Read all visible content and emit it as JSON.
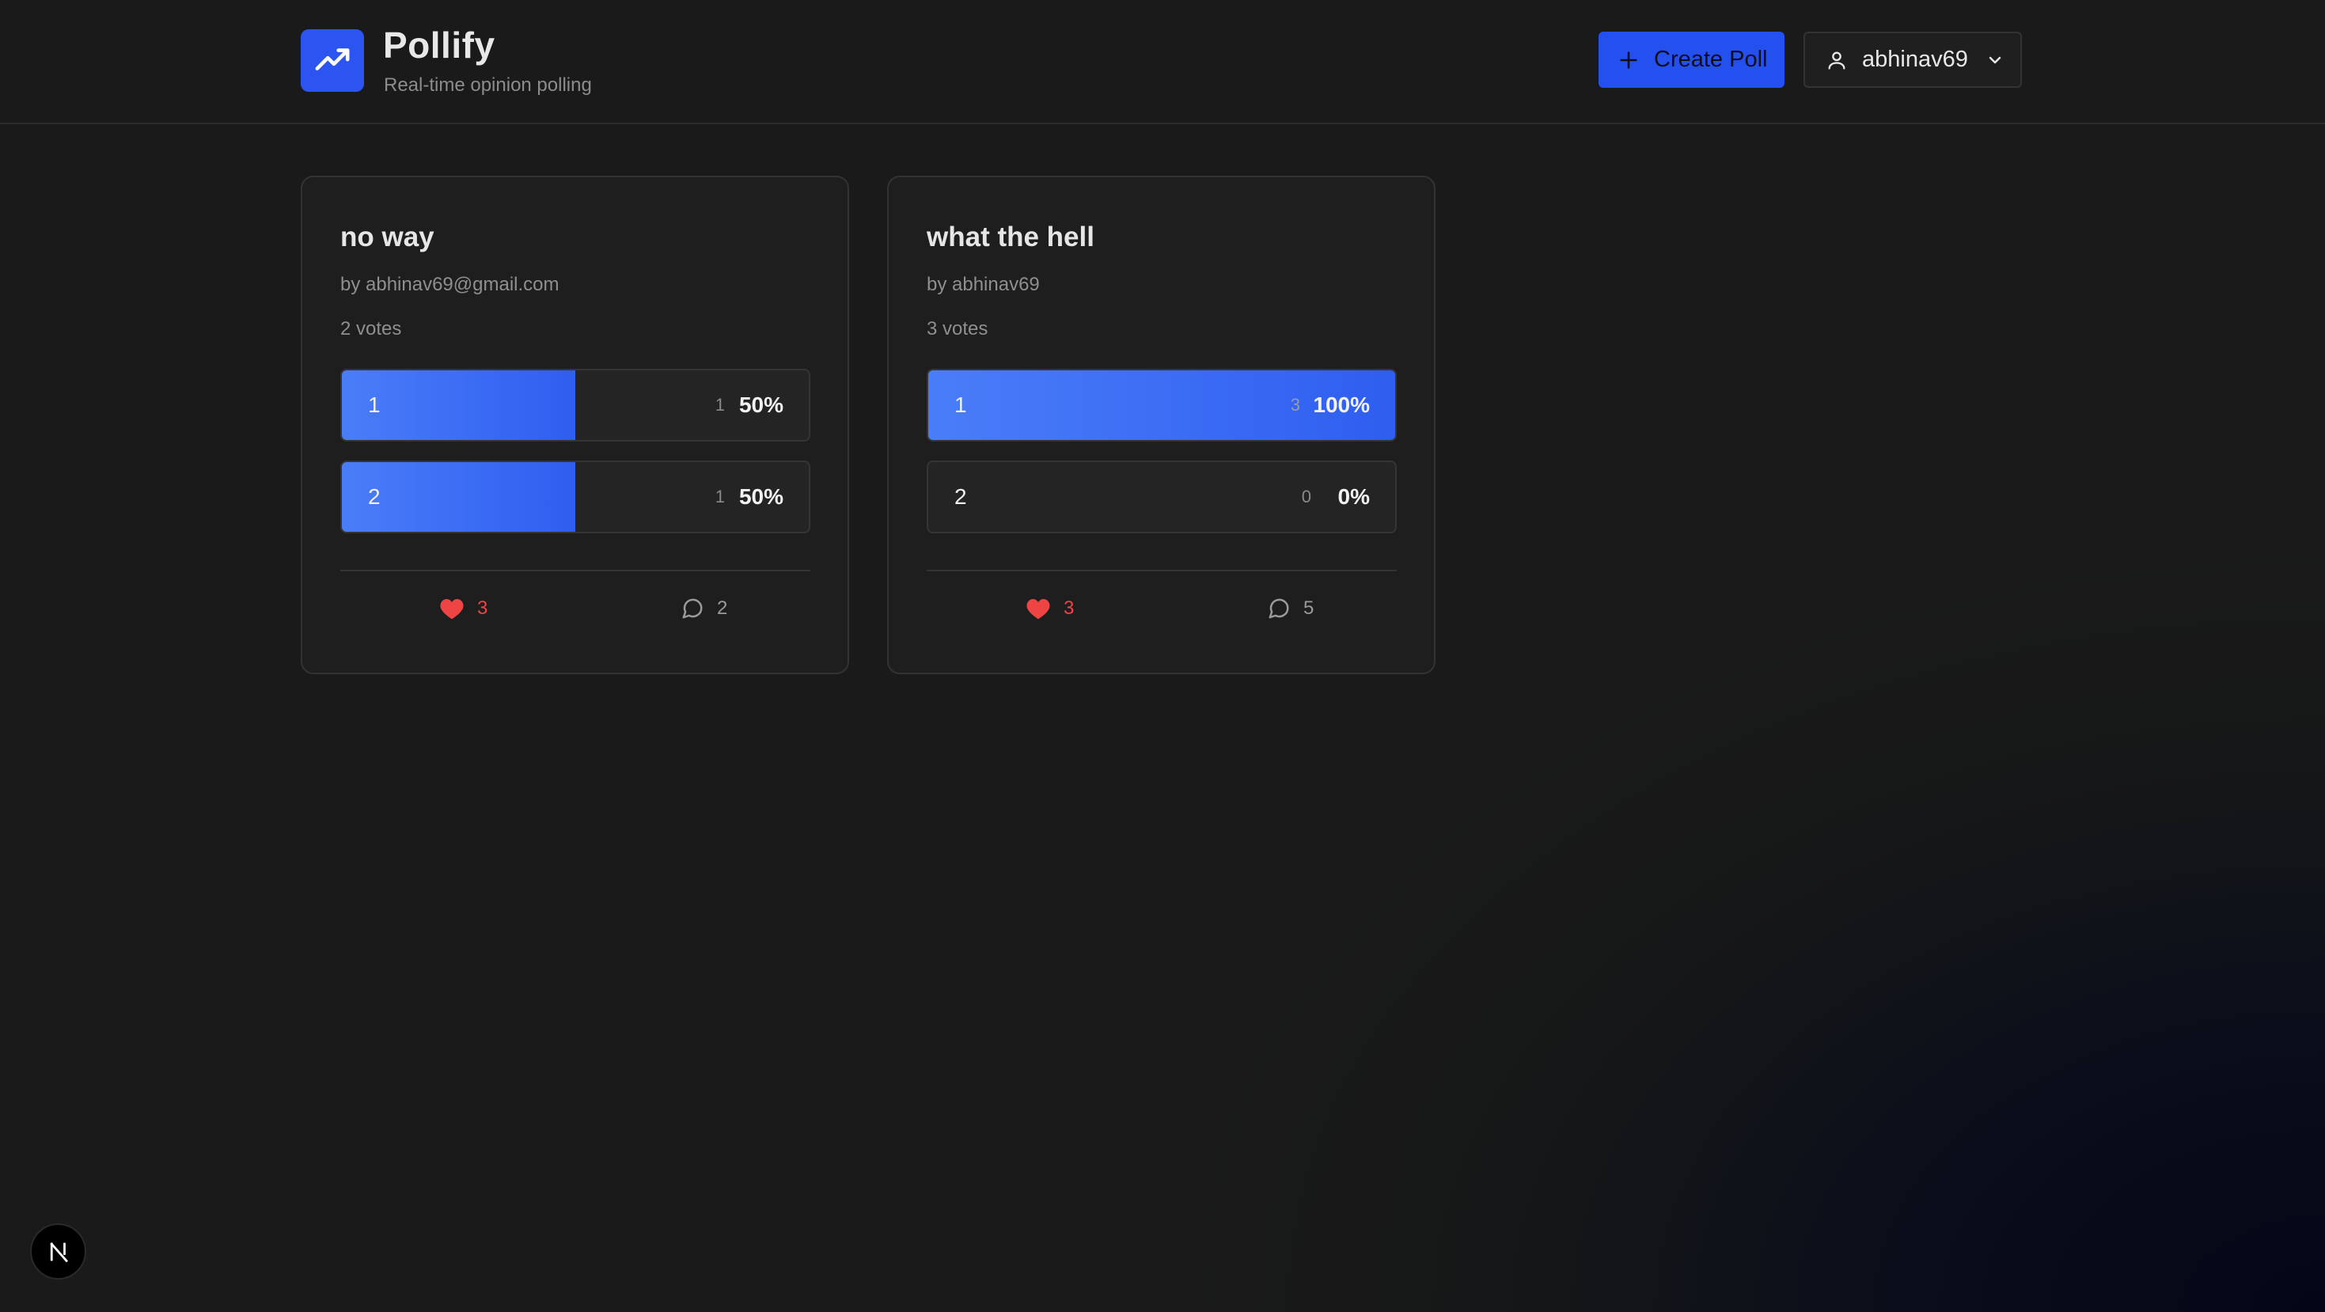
{
  "app": {
    "title": "Pollify",
    "subtitle": "Real-time opinion polling",
    "logo_icon": "trending-up-icon",
    "accent_color": "#2c54f0"
  },
  "header": {
    "create_label": "Create Poll",
    "user_name": "abhinav69"
  },
  "polls": [
    {
      "title": "no way",
      "author": "by abhinav69@gmail.com",
      "votes": "2 votes",
      "options": [
        {
          "label": "1",
          "count": "1",
          "percent": "50%",
          "fraction": 0.5
        },
        {
          "label": "2",
          "count": "1",
          "percent": "50%",
          "fraction": 0.5
        }
      ],
      "likes": "3",
      "comments": "2"
    },
    {
      "title": "what the hell",
      "author": "by abhinav69",
      "votes": "3 votes",
      "options": [
        {
          "label": "1",
          "count": "3",
          "percent": "100%",
          "fraction": 1.0
        },
        {
          "label": "2",
          "count": "0",
          "percent": "0%",
          "fraction": 0.0
        }
      ],
      "likes": "3",
      "comments": "5"
    }
  ],
  "footer": {
    "badge_icon": "nextjs-icon"
  }
}
